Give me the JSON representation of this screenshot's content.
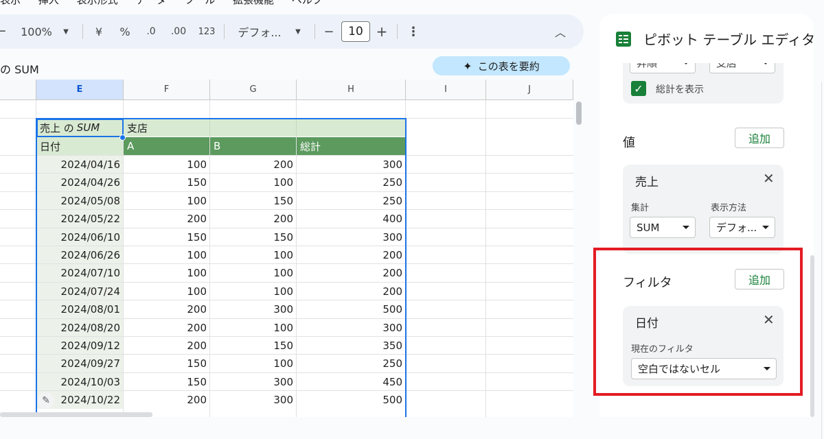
{
  "menu": [
    "表示",
    "挿入",
    "表示形式",
    "データ",
    "ツール",
    "拡張機能",
    "ヘルプ"
  ],
  "toolbar": {
    "zoom": "100%",
    "currency": "¥",
    "percent": "%",
    "dec_decrease": ".0",
    "dec_increase": ".00",
    "number_format": "123",
    "font": "デフォ...",
    "minus": "−",
    "font_size": "10",
    "plus": "+",
    "more": "⋮",
    "collapse": "︿"
  },
  "formula_bar": {
    "text": "の SUM",
    "summarize_label": "この表を要約"
  },
  "grid": {
    "columns": [
      "E",
      "F",
      "G",
      "H",
      "I",
      "J"
    ],
    "selected_column": "E",
    "pivot_header": {
      "label": "売上 の ",
      "label_italic": "SUM",
      "branch_label": "支店"
    },
    "sub_header": [
      "日付",
      "A",
      "B",
      "総計"
    ],
    "rows": [
      [
        "2024/04/16",
        "100",
        "200",
        "300"
      ],
      [
        "2024/04/26",
        "150",
        "100",
        "250"
      ],
      [
        "2024/05/08",
        "100",
        "150",
        "250"
      ],
      [
        "2024/05/22",
        "200",
        "200",
        "400"
      ],
      [
        "2024/06/10",
        "150",
        "150",
        "300"
      ],
      [
        "2024/06/26",
        "100",
        "100",
        "200"
      ],
      [
        "2024/07/10",
        "100",
        "100",
        "200"
      ],
      [
        "2024/07/24",
        "100",
        "100",
        "200"
      ],
      [
        "2024/08/01",
        "200",
        "300",
        "500"
      ],
      [
        "2024/08/20",
        "200",
        "100",
        "300"
      ],
      [
        "2024/09/12",
        "200",
        "150",
        "350"
      ],
      [
        "2024/09/27",
        "150",
        "100",
        "250"
      ],
      [
        "2024/10/03",
        "150",
        "300",
        "450"
      ],
      [
        "2024/10/22",
        "200",
        "300",
        "500"
      ]
    ]
  },
  "panel": {
    "title": "ピボット テーブル エディタ",
    "top_selects": [
      "昇順",
      "支店"
    ],
    "show_totals_label": "総計を表示",
    "values_section": {
      "title": "値",
      "add_label": "追加",
      "card_title": "売上",
      "summarize_label": "集計",
      "summarize_value": "SUM",
      "show_as_label": "表示方法",
      "show_as_value": "デフォ..."
    },
    "filter_section": {
      "title": "フィルタ",
      "add_label": "追加",
      "card_title": "日付",
      "status_label": "現在のフィルタ",
      "status_value": "空白ではないセル"
    }
  },
  "colors": {
    "pivot_header_bg": "#d9ead3",
    "pivot_subheader_bg": "#5c9a5e",
    "date_col_bg": "#ecf2ea",
    "selection_blue": "#1a73e8",
    "highlight_red": "#e31b23",
    "add_text_green": "#188038"
  }
}
